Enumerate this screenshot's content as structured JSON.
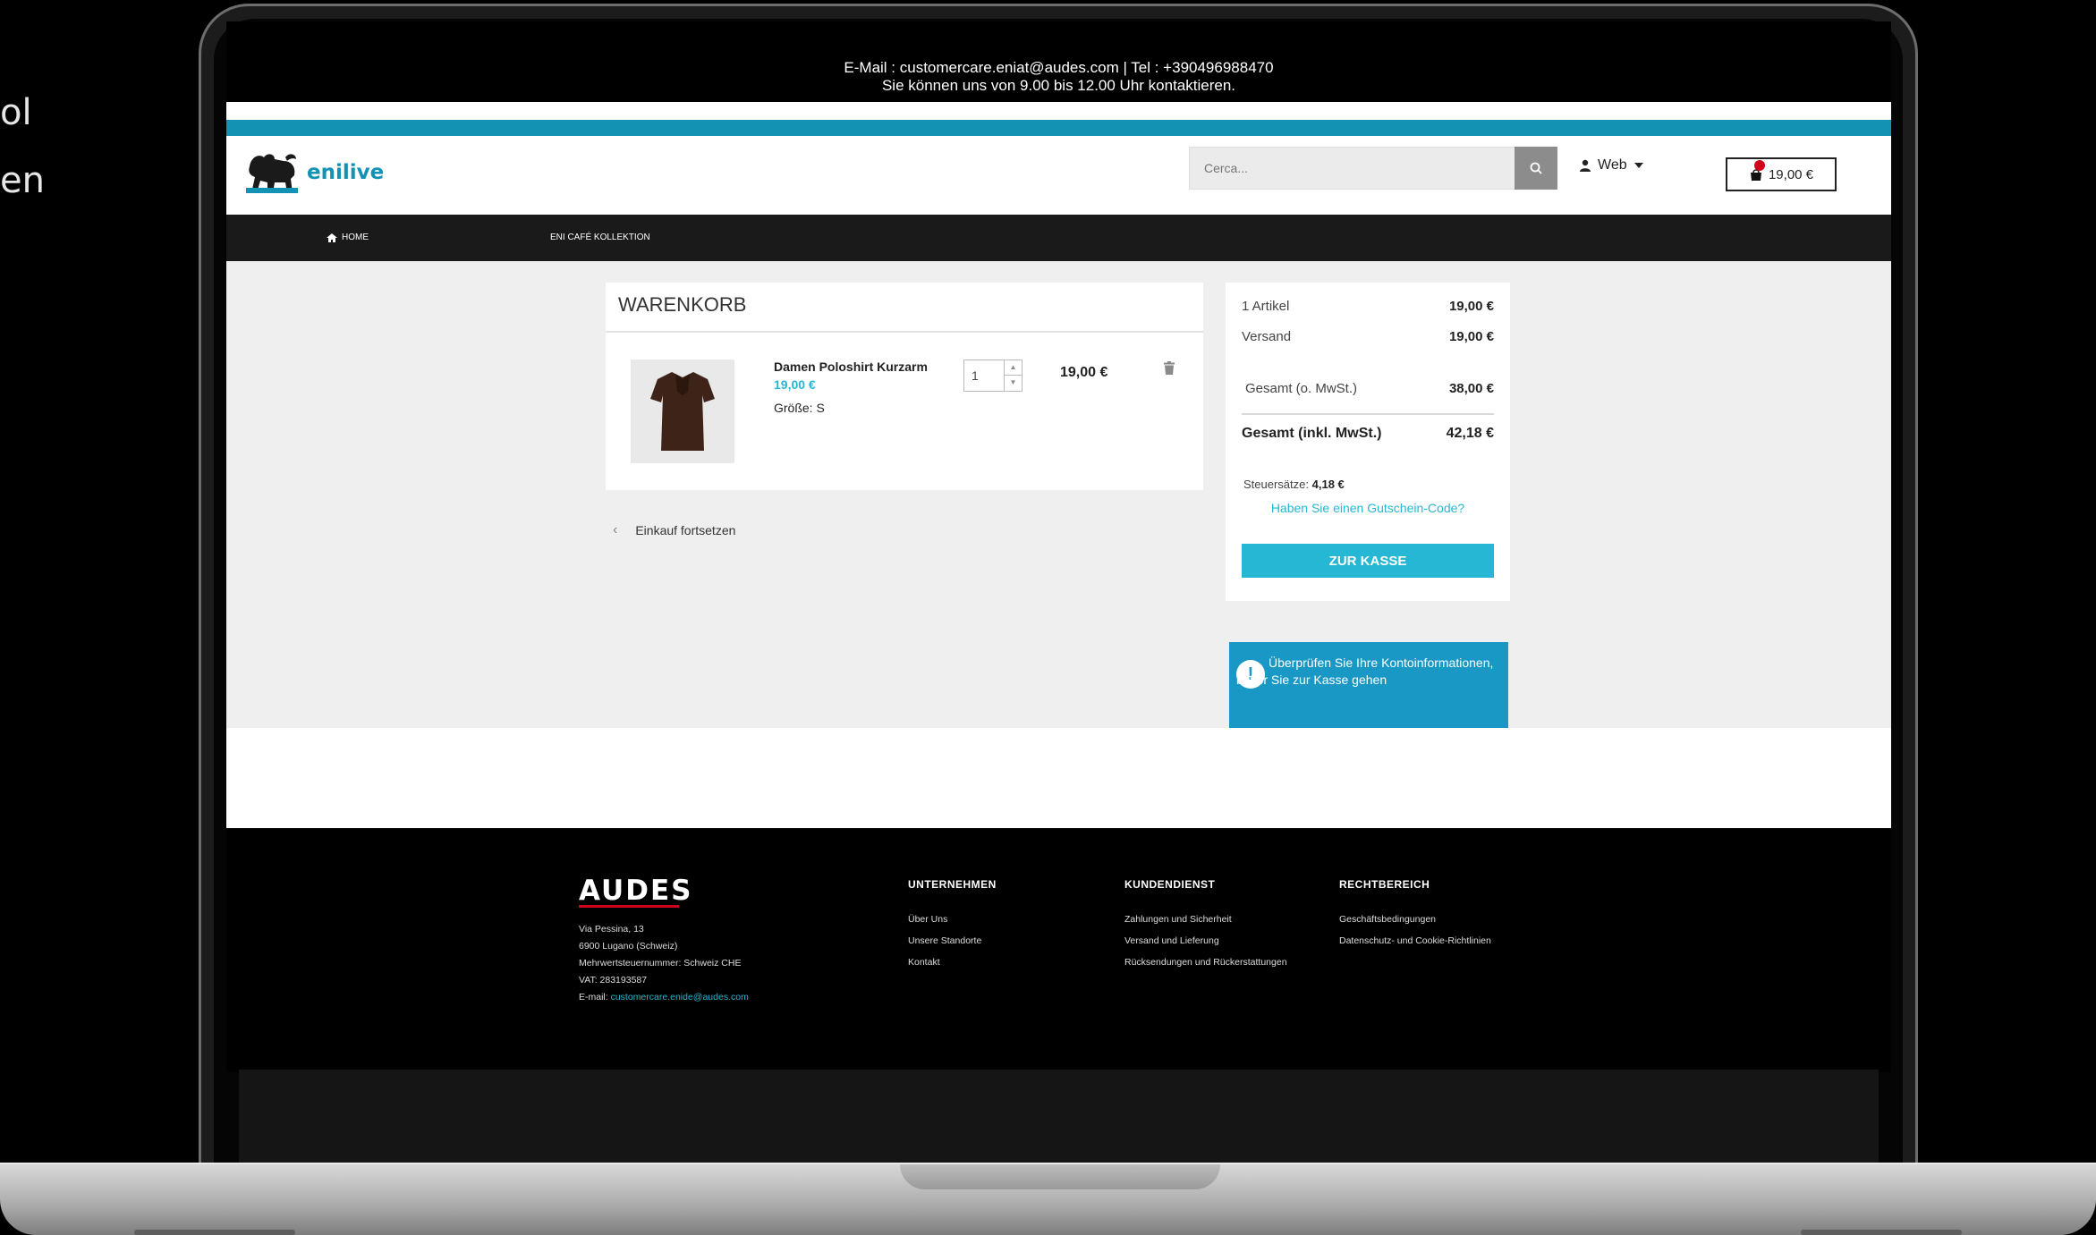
{
  "side_text": [
    "ol",
    "en"
  ],
  "topbar": {
    "line1": "E-Mail : customercare.eniat@audes.com | Tel : +390496988470",
    "line2": "Sie können uns von 9.00 bis 12.00 Uhr kontaktieren."
  },
  "header": {
    "logo_text": "enilive",
    "search_placeholder": "Cerca...",
    "user_label": "Web",
    "cart_total": "19,00 €"
  },
  "nav": {
    "items": [
      "HOME",
      "ENI CAFÉ KOLLEKTION"
    ]
  },
  "cart": {
    "title": "WARENKORB",
    "item": {
      "name": "Damen Poloshirt Kurzarm",
      "price": "19,00 €",
      "size_label": "Größe:",
      "size_value": "S",
      "quantity": "1",
      "line_total": "19,00 €"
    },
    "continue_label": "Einkauf fortsetzen"
  },
  "summary": {
    "items_label": "1 Artikel",
    "items_value": "19,00 €",
    "shipping_label": "Versand",
    "shipping_value": "19,00 €",
    "net_label": "Gesamt (o. MwSt.)",
    "net_value": "38,00 €",
    "gross_label": "Gesamt (inkl. MwSt.)",
    "gross_value": "42,18 €",
    "tax_label": "Steuersätze:",
    "tax_value": "4,18 €",
    "voucher_link": "Haben Sie einen Gutschein-Code?",
    "checkout_label": "ZUR KASSE"
  },
  "notice": {
    "text": "Überprüfen Sie Ihre Kontoinformationen, bevor Sie zur Kasse gehen"
  },
  "footer": {
    "brand": "AUDES",
    "address": [
      "Via Pessina, 13",
      "6900 Lugano (Schweiz)",
      "Mehrwertsteuernummer: Schweiz CHE",
      "VAT: 283193587"
    ],
    "email_label": "E-mail:",
    "email": "customercare.enide@audes.com",
    "columns": [
      {
        "title": "UNTERNEHMEN",
        "links": [
          "Über Uns",
          "Unsere Standorte",
          "Kontakt"
        ]
      },
      {
        "title": "KUNDENDIENST",
        "links": [
          "Zahlungen und Sicherheit",
          "Versand und Lieferung",
          "Rücksendungen und Rückerstattungen"
        ]
      },
      {
        "title": "RECHTBEREICH",
        "links": [
          "Geschäftsbedingungen",
          "Datenschutz- und Cookie-Richtlinien"
        ]
      }
    ]
  },
  "colors": {
    "accent_teal": "#1492b4",
    "button_cyan": "#25b7d3",
    "notice_blue": "#1a98c5",
    "badge_red": "#d0021b"
  },
  "icons": [
    "home-icon",
    "search-icon",
    "user-icon",
    "caret-down-icon",
    "cart-icon",
    "trash-icon",
    "chevron-left-icon",
    "exclamation-icon"
  ]
}
